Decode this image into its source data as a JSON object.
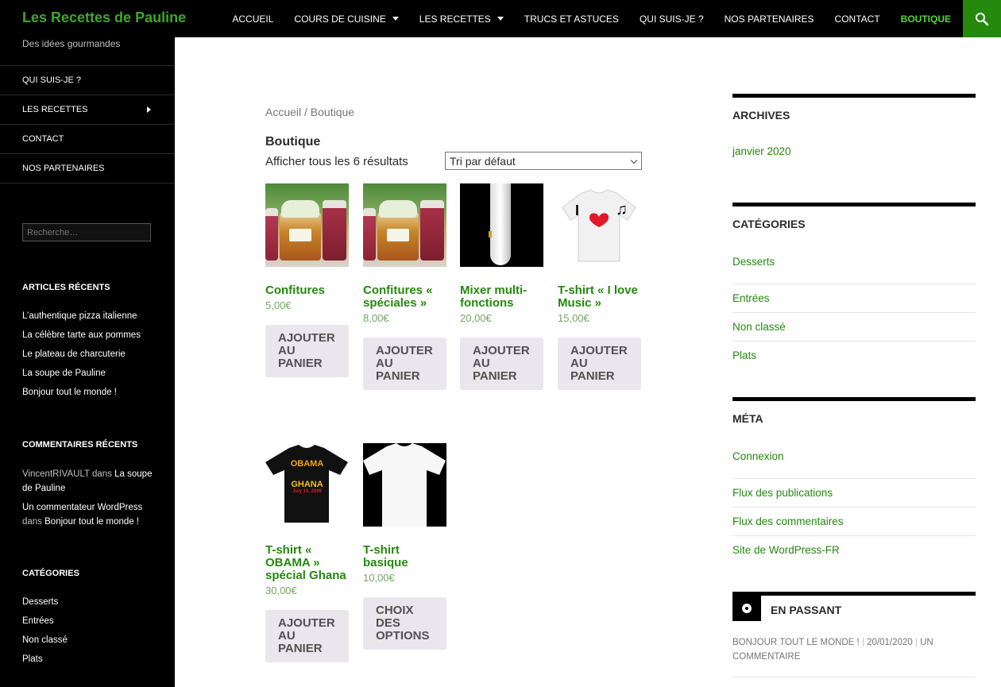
{
  "header": {
    "site_title": "Les Recettes de Pauline",
    "nav": [
      {
        "label": "ACCUEIL",
        "dropdown": false,
        "active": false
      },
      {
        "label": "COURS DE CUISINE",
        "dropdown": true,
        "active": false
      },
      {
        "label": "LES RECETTES",
        "dropdown": true,
        "active": false
      },
      {
        "label": "TRUCS ET ASTUCES",
        "dropdown": false,
        "active": false
      },
      {
        "label": "QUI SUIS-JE ?",
        "dropdown": false,
        "active": false
      },
      {
        "label": "NOS PARTENAIRES",
        "dropdown": false,
        "active": false
      },
      {
        "label": "CONTACT",
        "dropdown": false,
        "active": false
      },
      {
        "label": "BOUTIQUE",
        "dropdown": false,
        "active": true
      }
    ],
    "search_icon": "search-icon",
    "accent_color": "#24890d"
  },
  "left_sidebar": {
    "tagline": "Des idées gourmandes",
    "menu": [
      "QUI SUIS-JE ?",
      "LES RECETTES",
      "CONTACT",
      "NOS PARTENAIRES"
    ],
    "search_placeholder": "Recherche…",
    "recent_posts_title": "ARTICLES RÉCENTS",
    "recent_posts": [
      "L’authentique pizza italienne",
      "La célèbre tarte aux pommes",
      "Le plateau de charcuterie",
      "La soupe de Pauline",
      "Bonjour tout le monde !"
    ],
    "recent_comments_title": "COMMENTAIRES RÉCENTS",
    "recent_comments": [
      {
        "author": "VincentRIVAULT",
        "sep": "dans",
        "post": "La soupe de Pauline"
      },
      {
        "author": "Un commentateur WordPress",
        "sep": "dans",
        "post": "Bonjour tout le monde !"
      }
    ],
    "categories_title": "CATÉGORIES",
    "categories": [
      "Desserts",
      "Entrées",
      "Non classé",
      "Plats"
    ]
  },
  "main": {
    "breadcrumb": "Accueil / Boutique",
    "title": "Boutique",
    "result_count": "Afficher tous les 6 résultats",
    "ordering": "Tri par défaut",
    "products": [
      {
        "title": "Confitures",
        "price": "5,00€",
        "button": "AJOUTER AU PANIER"
      },
      {
        "title": "Confitures « spéciales »",
        "price": "8,00€",
        "button": "AJOUTER AU PANIER"
      },
      {
        "title": "Mixer multi-fonctions",
        "price": "20,00€",
        "button": "AJOUTER AU PANIER"
      },
      {
        "title": "T-shirt « I love Music »",
        "price": "15,00€",
        "button": "AJOUTER AU PANIER",
        "print": "I",
        "print2": "♫"
      },
      {
        "title": "T-shirt « OBAMA » spécial Ghana",
        "price": "30,00€",
        "button": "AJOUTER AU PANIER",
        "print": "OBAMA",
        "print2": "GHANA",
        "print3": "July 10, 2009"
      },
      {
        "title": "T-shirt basique",
        "price": "10,00€",
        "button": "CHOIX DES OPTIONS"
      }
    ]
  },
  "right_sidebar": {
    "archives_title": "ARCHIVES",
    "archives": [
      "janvier 2020"
    ],
    "categories_title": "CATÉGORIES",
    "categories": [
      "Desserts",
      "Entrées",
      "Non classé",
      "Plats"
    ],
    "meta_title": "MÉTA",
    "meta": [
      "Connexion",
      "Flux des publications",
      "Flux des commentaires",
      "Site de WordPress-FR"
    ],
    "passant_title": "EN PASSANT",
    "passant_post": "BONJOUR TOUT LE MONDE !",
    "passant_date": "20/01/2020",
    "passant_comment": "UN COMMENTAIRE"
  }
}
